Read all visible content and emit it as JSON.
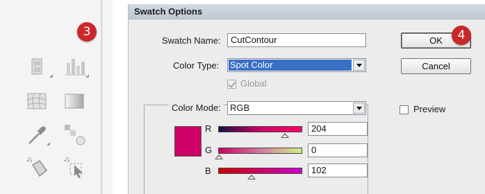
{
  "callouts": {
    "toolbar_badge": "3",
    "ok_badge": "4"
  },
  "toolbar": {
    "tools": [
      "symbol-sprayer-icon",
      "column-graph-icon",
      "mesh-icon",
      "gradient-icon",
      "eyedropper-icon",
      "blend-icon",
      "live-paint-bucket-icon",
      "live-paint-selection-icon"
    ]
  },
  "dialog": {
    "title": "Swatch Options",
    "swatch_name_label": "Swatch Name:",
    "swatch_name_value": "CutContour",
    "color_type_label": "Color Type:",
    "color_type_value": "Spot Color",
    "global_label": "Global",
    "global_checked": true,
    "color_mode_label": "Color Mode:",
    "color_mode_value": "RGB",
    "preview_label": "Preview",
    "preview_checked": false,
    "ok_label": "OK",
    "cancel_label": "Cancel",
    "swatch_color": "#CC0066",
    "channels": [
      {
        "label": "R",
        "value": "204",
        "fraction": 0.8
      },
      {
        "label": "G",
        "value": "0",
        "fraction": 0.0
      },
      {
        "label": "B",
        "value": "102",
        "fraction": 0.4
      }
    ]
  },
  "colors": {
    "badge": "#C8282A",
    "selection": "#3A6FC4",
    "titlebar": "#C6CED8"
  }
}
